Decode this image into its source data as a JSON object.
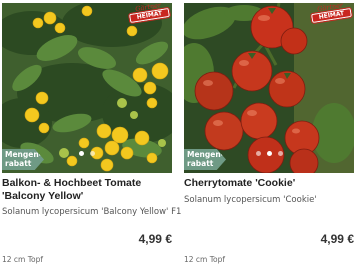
{
  "products": [
    {
      "title": "Balkon- & Hochbeet Tomate 'Balcony Yellow'",
      "subtitle": "Solanum lycopersicum 'Balcony Yellow' F1",
      "price": "4,99 €",
      "size": "12 cm Topf",
      "discount_badge": "Mengen-\nrabatt",
      "heimat_badge": {
        "top": "Gärtner",
        "main": "HEIMAT"
      },
      "image_desc": "yellow cherry tomatoes on plant",
      "carousel_dots": 2,
      "active_dot": 0
    },
    {
      "title": "Cherrytomate 'Cookie'",
      "subtitle": "Solanum lycopersicum 'Cookie'",
      "price": "4,99 €",
      "size": "12 cm Topf",
      "discount_badge": "Mengen-\nrabatt",
      "heimat_badge": {
        "top": "Gärtner",
        "main": "HEIMAT"
      },
      "image_desc": "red cherry tomatoes on vine",
      "carousel_dots": 3,
      "active_dot": 1
    }
  ],
  "colors": {
    "badge_green": "#6f9a85",
    "heimat_red": "#c9261f",
    "text": "#333333"
  }
}
